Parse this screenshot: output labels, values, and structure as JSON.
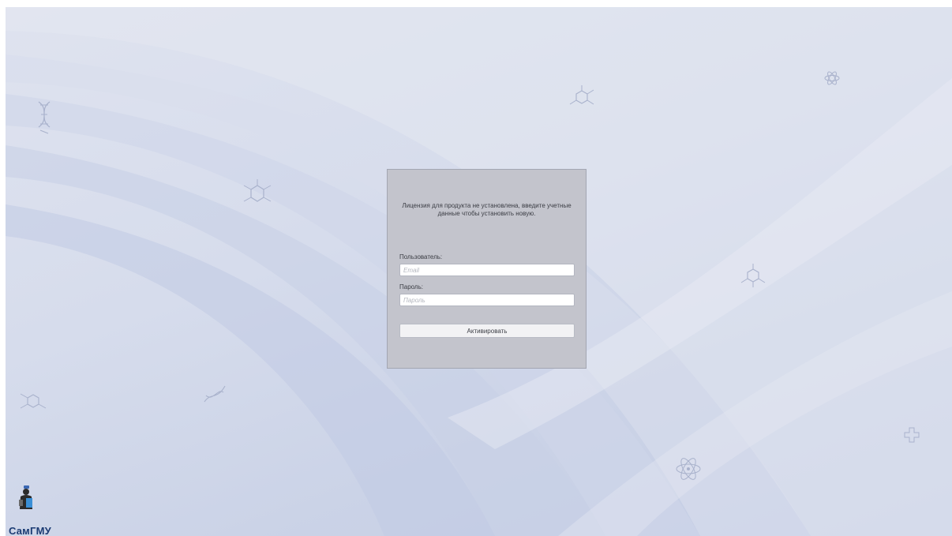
{
  "dialog": {
    "message": "Лицензия для продукта не установлена, введите учетные данные чтобы установить новую.",
    "user_label": "Пользователь:",
    "user_placeholder": "Email",
    "password_label": "Пароль:",
    "password_placeholder": "Пароль",
    "activate_label": "Активировать"
  },
  "branding": {
    "logo_text": "СамГМУ",
    "logo_color": "#1b3b73"
  },
  "background": {
    "colors": [
      "#dfe3ef",
      "#c3cce4"
    ],
    "decor_icons": [
      "dna-icon",
      "molecule-icon",
      "atom-icon",
      "medical-cross-icon"
    ]
  }
}
